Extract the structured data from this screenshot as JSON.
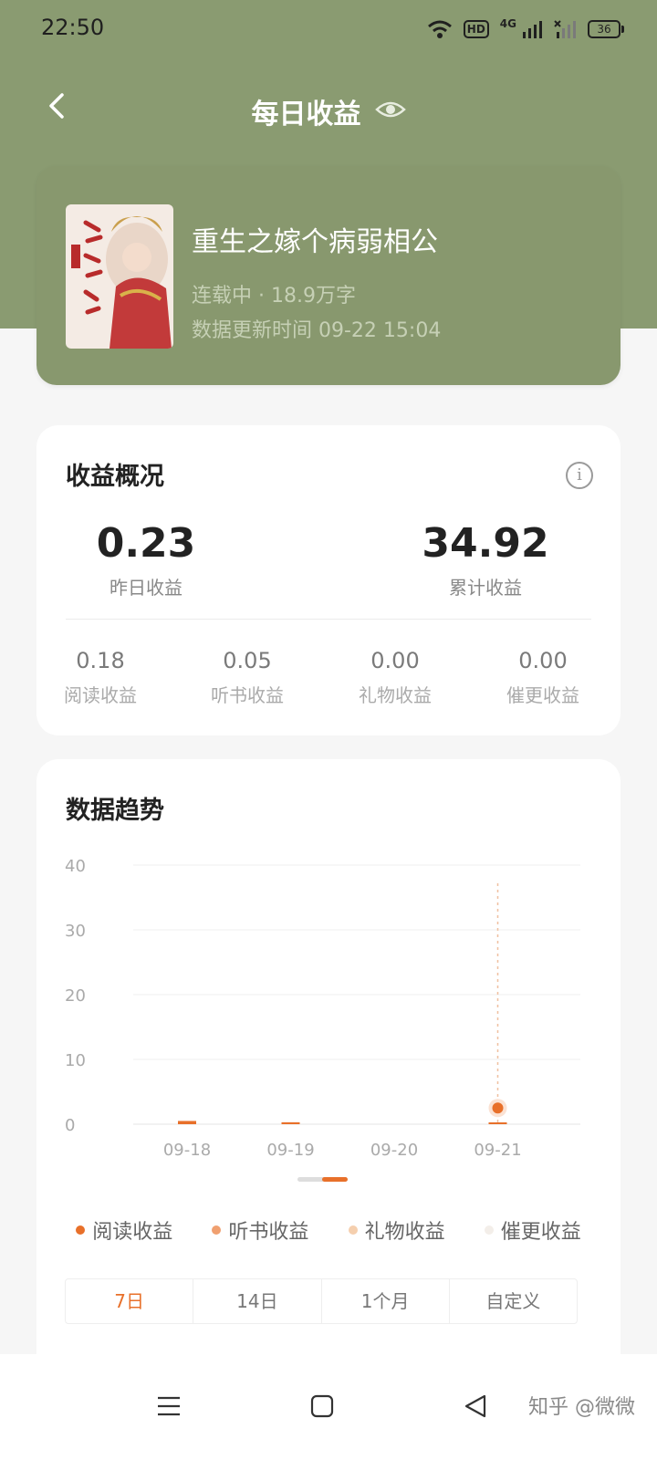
{
  "status_bar": {
    "time": "22:50",
    "hd_label": "HD",
    "network_label": "4G",
    "battery": "36"
  },
  "header": {
    "title": "每日收益"
  },
  "book": {
    "title": "重生之嫁个病弱相公",
    "meta": "连载中 · 18.9万字",
    "update": "数据更新时间 09-22 15:04"
  },
  "income": {
    "title": "收益概况",
    "yesterday_value": "0.23",
    "yesterday_label": "昨日收益",
    "total_value": "34.92",
    "total_label": "累计收益",
    "breakdown": [
      {
        "value": "0.18",
        "label": "阅读收益"
      },
      {
        "value": "0.05",
        "label": "听书收益"
      },
      {
        "value": "0.00",
        "label": "礼物收益"
      },
      {
        "value": "0.00",
        "label": "催更收益"
      }
    ]
  },
  "trend": {
    "title": "数据趋势",
    "ranges": [
      "7日",
      "14日",
      "1个月",
      "自定义"
    ],
    "active_range": "7日"
  },
  "chart_data": {
    "type": "bar",
    "categories": [
      "09-18",
      "09-19",
      "09-20",
      "09-21"
    ],
    "ylim": [
      0,
      40
    ],
    "yticks": [
      "40",
      "30",
      "20",
      "10",
      "0"
    ],
    "series": [
      {
        "name": "阅读收益",
        "color": "#e8702a",
        "values": [
          0.5,
          0.3,
          0,
          0.23
        ]
      },
      {
        "name": "听书收益",
        "color": "#f0a070",
        "values": [
          0,
          0,
          0,
          0
        ]
      },
      {
        "name": "礼物收益",
        "color": "#f5cfae",
        "values": [
          0,
          0,
          0,
          0
        ]
      },
      {
        "name": "催更收益",
        "color": "#f3eee9",
        "values": [
          0,
          0,
          0,
          0
        ]
      }
    ],
    "highlight_category": "09-21",
    "highlight_point": 2.5,
    "grid": true
  },
  "nav": {
    "watermark": "知乎 @微微"
  },
  "icons": {
    "back": "back-arrow-icon",
    "eye": "eye-icon",
    "info": "info-icon",
    "menu": "menu-icon",
    "home": "home-icon",
    "back_nav": "triangle-back-icon"
  }
}
